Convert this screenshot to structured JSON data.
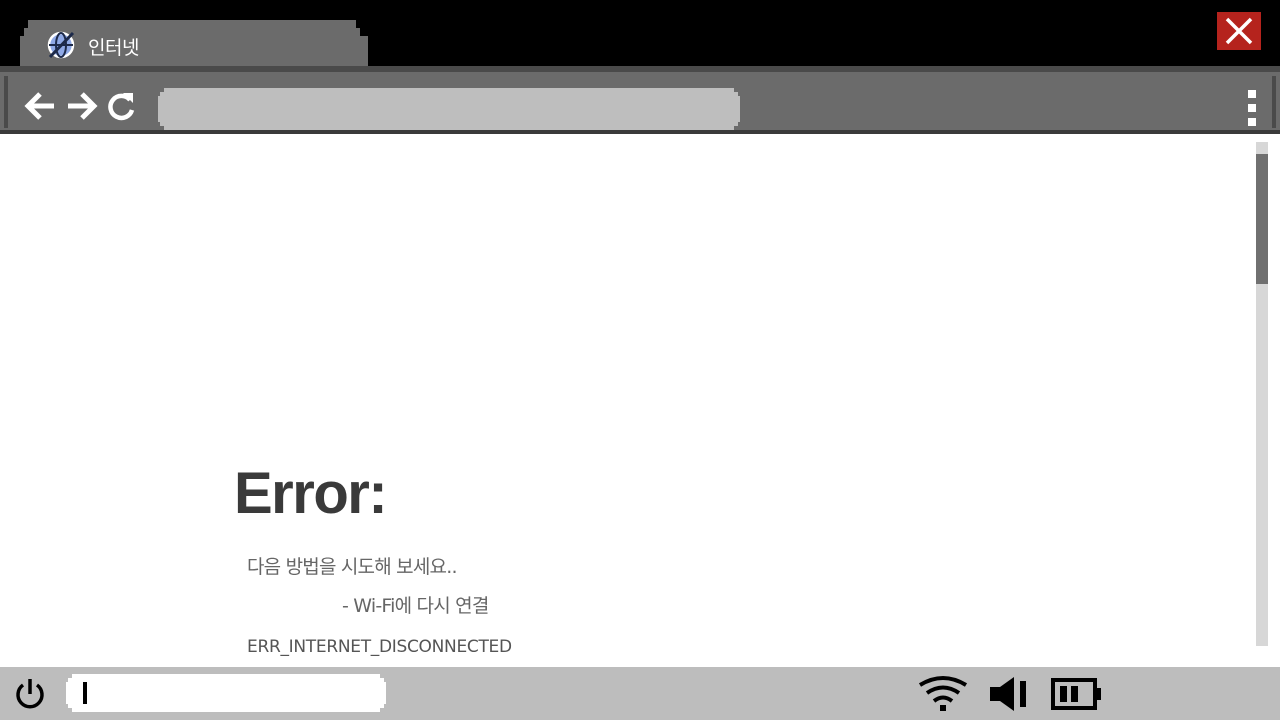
{
  "window": {
    "tab_label": "인터넷",
    "close_color": "#b5231d"
  },
  "toolbar": {
    "address_value": "",
    "address_placeholder": ""
  },
  "page": {
    "error_title": "Error:",
    "hint": "다음 방법을 시도해 보세요..",
    "hint_item": "- Wi-Fi에 다시 연결",
    "error_code": "ERR_INTERNET_DISCONNECTED"
  },
  "taskbar": {
    "search_value": ""
  },
  "icons": {
    "tab": "globe-icon",
    "close": "close-icon",
    "back": "arrow-left-icon",
    "forward": "arrow-right-icon",
    "reload": "reload-icon",
    "menu": "kebab-menu-icon",
    "power": "power-icon",
    "wifi": "wifi-icon",
    "volume": "volume-icon",
    "battery": "battery-icon"
  }
}
